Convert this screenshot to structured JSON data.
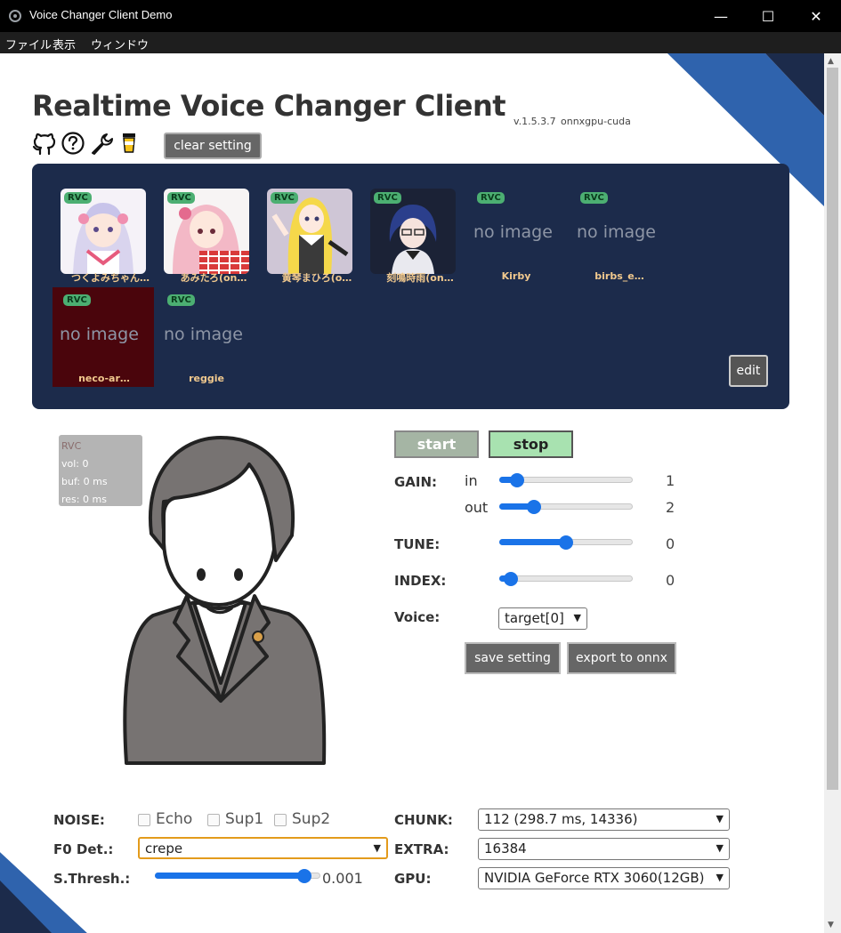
{
  "window": {
    "title": "Voice Changer Client Demo",
    "controls": {
      "minimize": "—",
      "maximize": "☐",
      "close": "✕"
    }
  },
  "menubar": {
    "items": [
      "ファイル",
      "表示",
      "ウィンドウ"
    ]
  },
  "header": {
    "title": "Realtime Voice Changer Client",
    "version": "v.1.5.3.7",
    "build": "onnxgpu-cuda",
    "icons": [
      "github-icon",
      "help-icon",
      "wrench-icon",
      "coffee-icon"
    ],
    "clear_label": "clear setting"
  },
  "slots": [
    {
      "badge": "RVC",
      "name": "つくよみちゃん…",
      "image": true
    },
    {
      "badge": "RVC",
      "name": "あみたろ(on…",
      "image": true
    },
    {
      "badge": "RVC",
      "name": "黄琴まひろ(o…",
      "image": true
    },
    {
      "badge": "RVC",
      "name": "刻鳴時雨(on…",
      "image": true
    },
    {
      "badge": "RVC",
      "name": "Kirby",
      "image": false,
      "noimage": "no image"
    },
    {
      "badge": "RVC",
      "name": "birbs_e…",
      "image": false,
      "noimage": "no image"
    },
    {
      "badge": "RVC",
      "name": "neco-ar…",
      "image": false,
      "noimage": "no image",
      "selected": true
    },
    {
      "badge": "RVC",
      "name": "reggie",
      "image": false,
      "noimage": "no image"
    }
  ],
  "edit_label": "edit",
  "status": {
    "model": "RVC",
    "vol": "vol: 0",
    "buf": "buf: 0 ms",
    "res": "res: 0 ms"
  },
  "controls": {
    "start_label": "start",
    "stop_label": "stop",
    "gain_label": "GAIN:",
    "in_label": "in",
    "out_label": "out",
    "gain_in": 1,
    "gain_out": 2,
    "tune_label": "TUNE:",
    "tune": 0,
    "index_label": "INDEX:",
    "index": 0,
    "voice_label": "Voice:",
    "voice_value": "target[0]",
    "save_label": "save setting",
    "export_label": "export to onnx"
  },
  "sliders": {
    "gain_in_frac": 0.09,
    "gain_out_frac": 0.23,
    "tune_frac": 0.5,
    "index_frac": 0.04,
    "sthresh_frac": 0.94
  },
  "bottom": {
    "noise_label": "NOISE:",
    "echo_label": "Echo",
    "sup1_label": "Sup1",
    "sup2_label": "Sup2",
    "f0_label": "F0 Det.:",
    "f0_value": "crepe",
    "sthresh_label": "S.Thresh.:",
    "sthresh_value": "0.001",
    "chunk_label": "CHUNK:",
    "chunk_value": "112 (298.7 ms, 14336)",
    "extra_label": "EXTRA:",
    "extra_value": "16384",
    "gpu_label": "GPU:",
    "gpu_value": "NVIDIA GeForce RTX 3060(12GB)"
  },
  "colors": {
    "panel": "#1c2b4b",
    "accent": "#1a73e8",
    "badge": "#4caf72",
    "selected": "#4a050c"
  }
}
